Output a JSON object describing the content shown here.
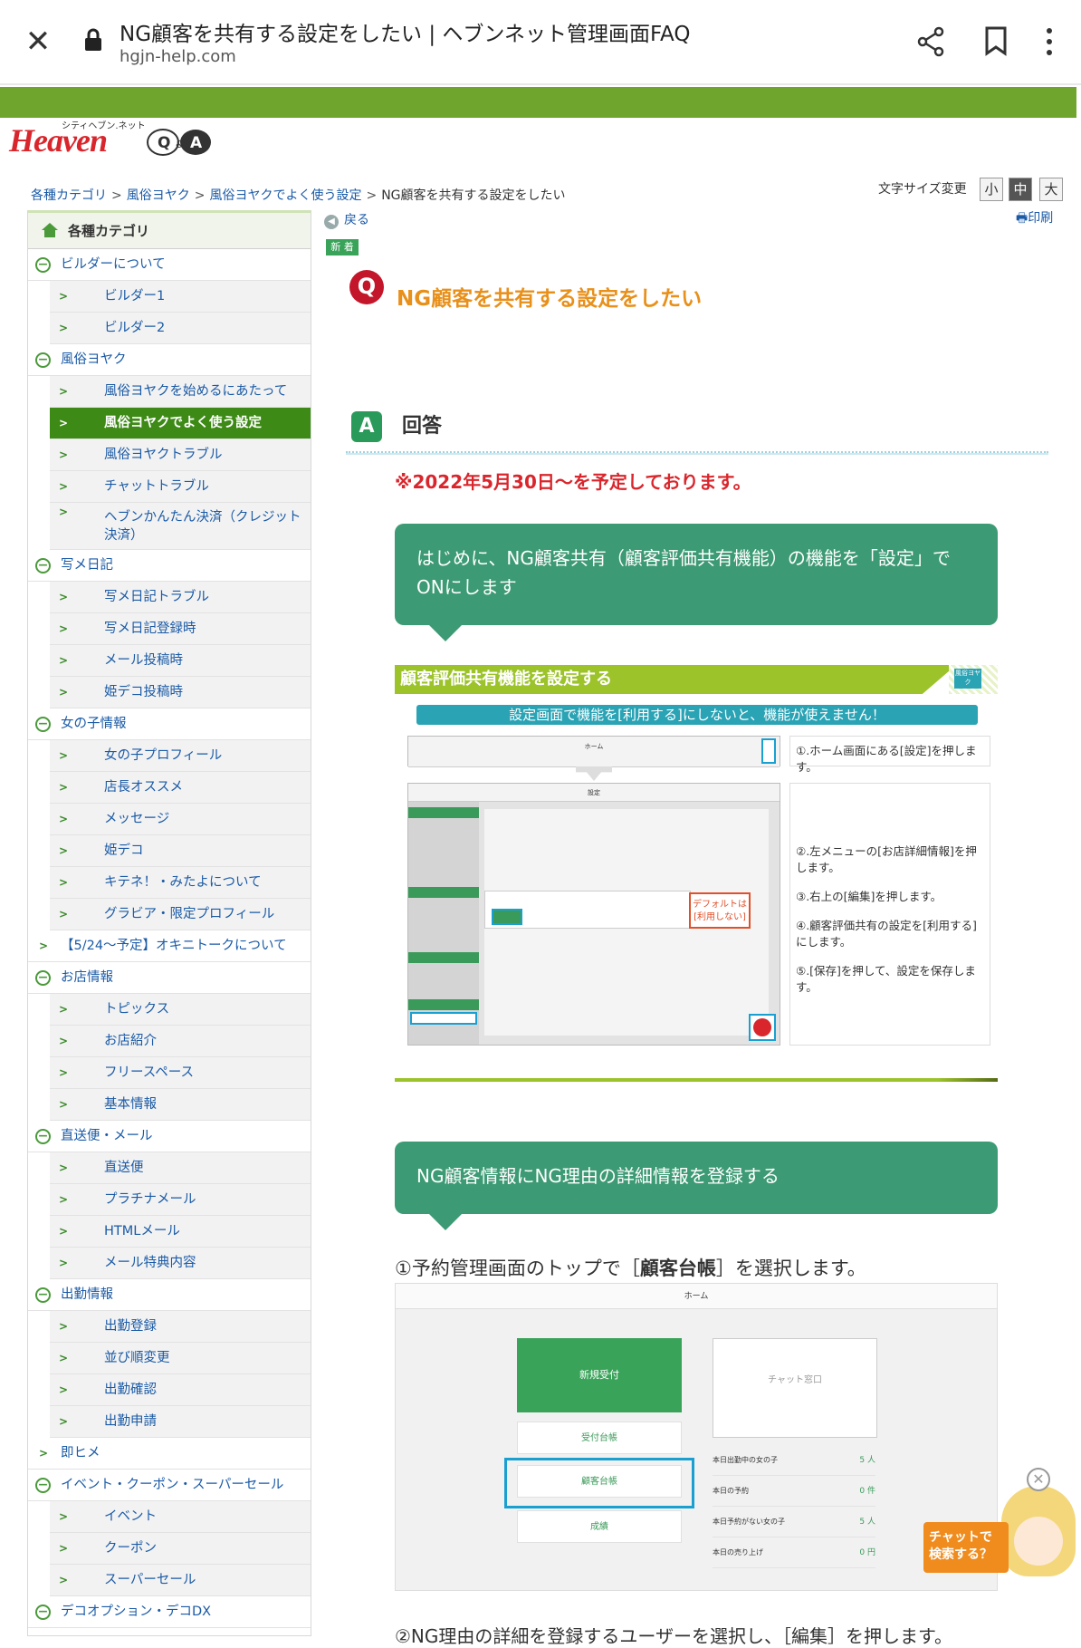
{
  "appbar": {
    "title": "NG顧客を共有する設定をしたい | ヘブンネット管理画面FAQ",
    "url": "hgjn-help.com"
  },
  "logo": {
    "text": "Heaven",
    "sub": "シティヘブン.ネット",
    "qa": "Q&A"
  },
  "breadcrumb": {
    "items": [
      "各種カテゴリ",
      "風俗ヨヤク",
      "風俗ヨヤクでよく使う設定"
    ],
    "current": "NG顧客を共有する設定をしたい"
  },
  "fontsize": {
    "label": "文字サイズ変更",
    "small": "小",
    "medium": "中",
    "large": "大"
  },
  "back_label": "戻る",
  "print_label": "印刷",
  "new_tag": "新 着",
  "sidebar": {
    "title": "各種カテゴリ",
    "rows": [
      {
        "type": "cat",
        "label": "ビルダーについて"
      },
      {
        "type": "sub",
        "label": "ビルダー1"
      },
      {
        "type": "sub",
        "label": "ビルダー2"
      },
      {
        "type": "cat",
        "label": "風俗ヨヤク"
      },
      {
        "type": "sub",
        "label": "風俗ヨヤクを始めるにあたって"
      },
      {
        "type": "sub",
        "label": "風俗ヨヤクでよく使う設定",
        "selected": true
      },
      {
        "type": "sub",
        "label": "風俗ヨヤクトラブル"
      },
      {
        "type": "sub",
        "label": "チャットトラブル"
      },
      {
        "type": "sub",
        "label": "ヘブンかんたん決済（クレジット決済）",
        "tall": true
      },
      {
        "type": "cat",
        "label": "写メ日記"
      },
      {
        "type": "sub",
        "label": "写メ日記トラブル"
      },
      {
        "type": "sub",
        "label": "写メ日記登録時"
      },
      {
        "type": "sub",
        "label": "メール投稿時"
      },
      {
        "type": "sub",
        "label": "姫デコ投稿時"
      },
      {
        "type": "cat",
        "label": "女の子情報"
      },
      {
        "type": "sub",
        "label": "女の子プロフィール"
      },
      {
        "type": "sub",
        "label": "店長オススメ"
      },
      {
        "type": "sub",
        "label": "メッセージ"
      },
      {
        "type": "sub",
        "label": "姫デコ"
      },
      {
        "type": "sub",
        "label": "キテネ！・みたよについて"
      },
      {
        "type": "sub",
        "label": "グラビア・限定プロフィール"
      },
      {
        "type": "link",
        "label": "【5/24〜予定】オキニトークについて"
      },
      {
        "type": "cat",
        "label": "お店情報"
      },
      {
        "type": "sub",
        "label": "トピックス"
      },
      {
        "type": "sub",
        "label": "お店紹介"
      },
      {
        "type": "sub",
        "label": "フリースペース"
      },
      {
        "type": "sub",
        "label": "基本情報"
      },
      {
        "type": "cat",
        "label": "直送便・メール"
      },
      {
        "type": "sub",
        "label": "直送便"
      },
      {
        "type": "sub",
        "label": "プラチナメール"
      },
      {
        "type": "sub",
        "label": "HTMLメール"
      },
      {
        "type": "sub",
        "label": "メール特典内容"
      },
      {
        "type": "cat",
        "label": "出勤情報"
      },
      {
        "type": "sub",
        "label": "出勤登録"
      },
      {
        "type": "sub",
        "label": "並び順変更"
      },
      {
        "type": "sub",
        "label": "出勤確認"
      },
      {
        "type": "sub",
        "label": "出勤申請"
      },
      {
        "type": "link",
        "label": "即ヒメ"
      },
      {
        "type": "cat",
        "label": "イベント・クーポン・スーパーセール"
      },
      {
        "type": "sub",
        "label": "イベント"
      },
      {
        "type": "sub",
        "label": "クーポン"
      },
      {
        "type": "sub",
        "label": "スーパーセール"
      },
      {
        "type": "cat",
        "label": "デコオプション・デコDX"
      }
    ]
  },
  "question": {
    "badge": "Q",
    "title": "NG顧客を共有する設定をしたい"
  },
  "answer": {
    "badge": "A",
    "title": "回答"
  },
  "notice": "※2022年5月30日〜を予定しております。",
  "box1": "はじめに、NG顧客共有（顧客評価共有機能）の機能を「設定」でONにします",
  "setup": {
    "band_title": "顧客評価共有機能を設定する",
    "band_tag": "風俗ヨヤク",
    "warning": "設定画面で機能を[利用する]にしないと、機能が使えません！",
    "shot1_title": "ホーム",
    "shot2_title": "設定",
    "callout": "デフォルトは[利用しない]",
    "note1": "①.ホーム画面にある[設定]を押します。",
    "note2": "②.左メニューの[お店詳細情報]を押します。",
    "note3": "③.右上の[編集]を押します。",
    "note4": "④.顧客評価共有の設定を[利用する]にします。",
    "note5": "⑤.[保存]を押して、設定を保存します。"
  },
  "box2": "NG顧客情報にNG理由の詳細情報を登録する",
  "step1": {
    "before": "①予約管理画面のトップで［",
    "bold": "顧客台帳",
    "after": "］を選択します。"
  },
  "mock": {
    "title": "ホーム",
    "new_reception": "新規受付",
    "chat": "チャット窓口",
    "ledger1": "受付台帳",
    "ledger2": "顧客台帳",
    "results": "成績",
    "stats": [
      {
        "label": "本日出勤中の女の子",
        "value": "5 人"
      },
      {
        "label": "本日の予約",
        "value": "0 件"
      },
      {
        "label": "本日予約がない女の子",
        "value": "5 人"
      },
      {
        "label": "本日の売り上げ",
        "value": "0 円"
      }
    ]
  },
  "step2_partial": "②NG理由の詳細を登録するユーザーを選択し、［編集］を押します。",
  "chatbot": {
    "label": "チャットで検索する？"
  }
}
